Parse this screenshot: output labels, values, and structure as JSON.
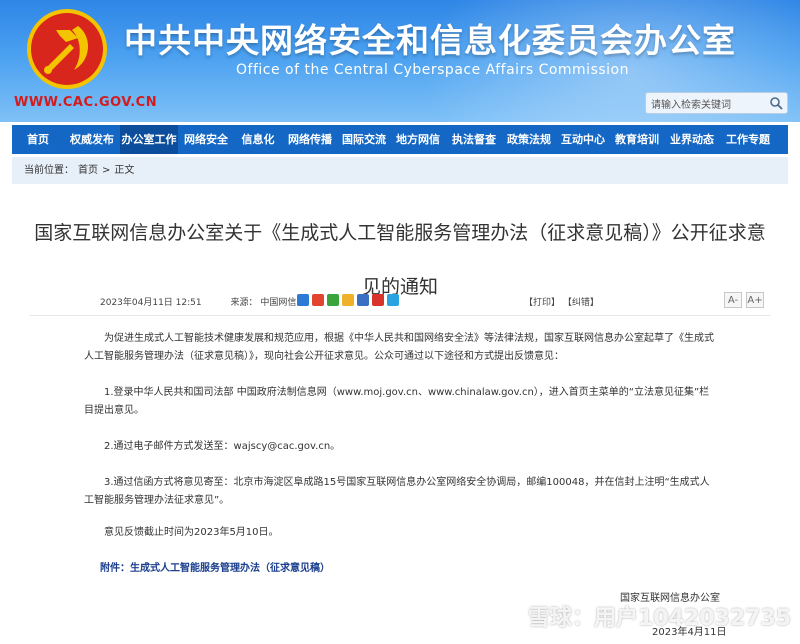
{
  "header": {
    "title_cn": "中共中央网络安全和信息化委员会办公室",
    "title_en": "Office of the Central Cyberspace Affairs Commission",
    "site_url": "WWW.CAC.GOV.CN",
    "search_placeholder": "请输入检索关键词"
  },
  "nav": {
    "items": [
      "首页",
      "权威发布",
      "办公室工作",
      "网络安全",
      "信息化",
      "网络传播",
      "国际交流",
      "地方网信",
      "执法督查",
      "政策法规",
      "互动中心",
      "教育培训",
      "业界动态",
      "工作专题"
    ],
    "active_index": 2
  },
  "breadcrumb": {
    "label": "当前位置：",
    "home": "首页",
    "sep": ">",
    "current": "正文"
  },
  "article": {
    "title": "国家互联网信息办公室关于《生成式人工智能服务管理办法（征求意见稿）》公开征求意见的通知",
    "date": "2023年04月11日 12:51",
    "source_label": "来源：",
    "source": "中国网信网",
    "print": "【打印】",
    "close": "【纠错】",
    "font_small": "A-",
    "font_large": "A+",
    "paragraphs": [
      "为促进生成式人工智能技术健康发展和规范应用，根据《中华人民共和国网络安全法》等法律法规，国家互联网信息办公室起草了《生成式人工智能服务管理办法（征求意见稿）》，现向社会公开征求意见。公众可通过以下途径和方式提出反馈意见：",
      "1.登录中华人民共和国司法部 中国政府法制信息网（www.moj.gov.cn、www.chinalaw.gov.cn），进入首页主菜单的“立法意见征集”栏目提出意见。",
      "2.通过电子邮件方式发送至：wajscy@cac.gov.cn。",
      "3.通过信函方式将意见寄至：北京市海淀区阜成路15号国家互联网信息办公室网络安全协调局，邮编100048，并在信封上注明“生成式人工智能服务管理办法征求意见”。",
      "意见反馈截止时间为2023年5月10日。"
    ],
    "attachment": "附件：生成式人工智能服务管理办法（征求意见稿）",
    "signature": "国家互联网信息办公室",
    "sign_date": "2023年4月11日"
  },
  "watermark": "雪球：用户1042032735",
  "colors": {
    "nav": "#1467c4",
    "nav_active": "#0c4e9c",
    "url": "#d31b1b",
    "attachment": "#1b3f8f"
  }
}
